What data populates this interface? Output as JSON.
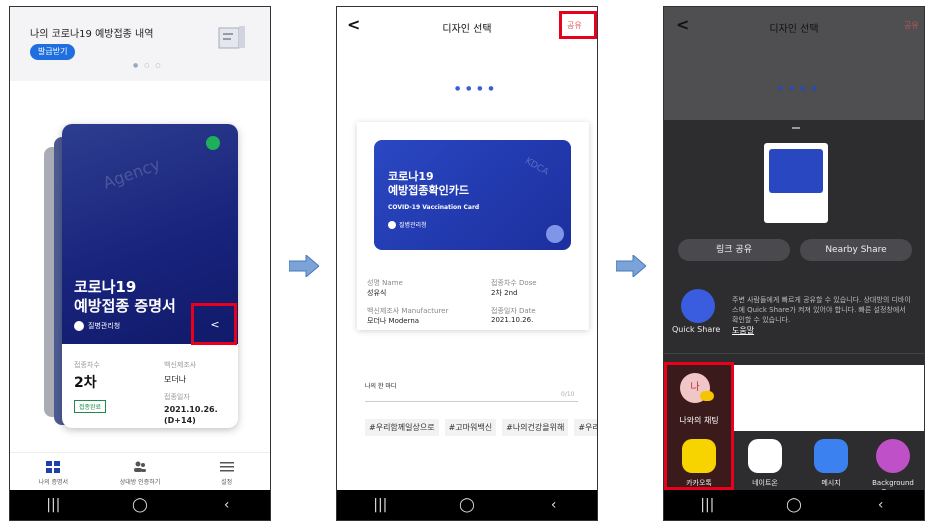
{
  "phone1": {
    "banner_title": "나의 코로나19 예방접종 내역",
    "issue_button": "발급받기",
    "card_title_line1": "코로나19",
    "card_title_line2": "예방접종 증명서",
    "org": "질병관리청",
    "watermark": "Agency",
    "dose_label": "접종차수",
    "dose_value": "2차",
    "complete_badge": "접종완료",
    "maker_label": "백신제조사",
    "maker_value": "모더나",
    "date_label": "접종일자",
    "date_value": "2021.10.26.",
    "date_days": "(D+14)",
    "tabs": [
      "나의 증명서",
      "상대방 인증하기",
      "설정"
    ]
  },
  "phone2": {
    "title": "디자인 선택",
    "share": "공유",
    "card_line1": "코로나19",
    "card_line2": "예방접종확인카드",
    "card_en": "COVID-19 Vaccination Card",
    "card_org": "질병관리청",
    "card_watermark": "KDCA",
    "name_label": "성명 Name",
    "name_value": "성유식",
    "dose_label": "접종차수 Dose",
    "dose_value": "2차 2nd",
    "maker_label": "백신제조사 Manufacturer",
    "maker_value": "모더나 Moderna",
    "date_label": "접종일자 Date",
    "date_value": "2021.10.26.",
    "msg_label": "나의 한 마디",
    "msg_count": "0/10",
    "tags": [
      "#우리함께일상으로",
      "#고마워백신",
      "#나의건강을위해",
      "#우리안"
    ]
  },
  "phone3": {
    "title": "디자인 선택",
    "share": "공유",
    "link_share": "링크 공유",
    "nearby_share": "Nearby Share",
    "quick_share_label": "Quick Share",
    "quick_share_text": "주변 사람들에게 빠르게 공유할 수 있습니다. 상대방의 디바이스에 Quick Share가 켜져 있어야 합니다. 빠른 설정창에서 확인할 수 있습니다.",
    "help_link": "도움말",
    "me_avatar": "나",
    "me_chat": "나와의 채팅",
    "apps": [
      "카카오톡",
      "네이트온",
      "메시지",
      "Background Eraser"
    ]
  },
  "nav": [
    "|||",
    "◯",
    "‹"
  ]
}
